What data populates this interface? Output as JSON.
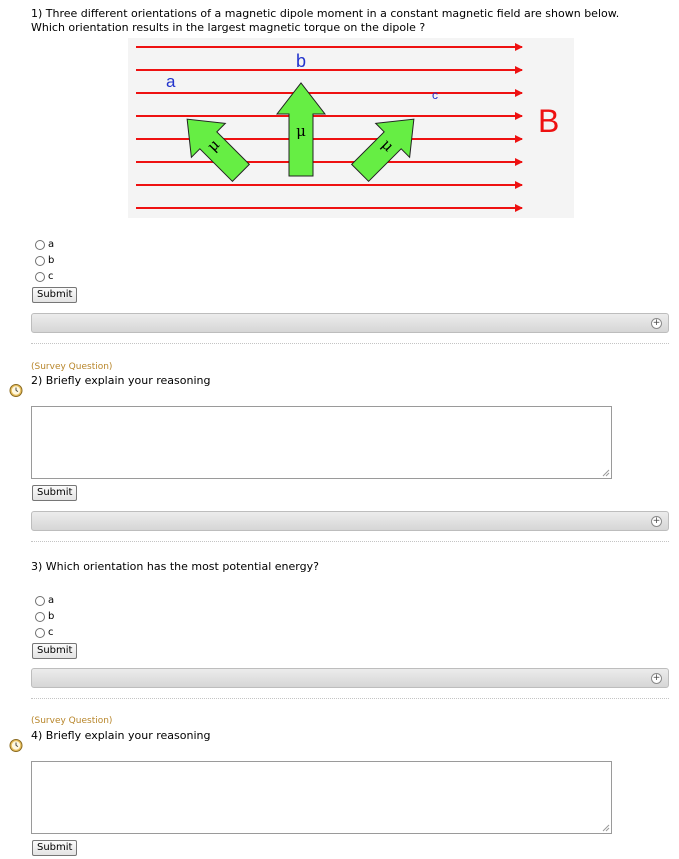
{
  "q1": {
    "text": "1) Three different orientations of a magnetic dipole moment in a constant magnetic field are shown below. Which orientation results in the largest magnetic torque on the dipole ?",
    "options": [
      "a",
      "b",
      "c"
    ],
    "submit": "Submit"
  },
  "figure": {
    "label_a": "a",
    "label_b": "b",
    "label_c": "c",
    "field_label": "B",
    "mu": "μ",
    "colors": {
      "field_line": "#ee1111",
      "arrow_fill": "#66ee44",
      "label_blue": "#2233cc",
      "bg": "#f4f4f4"
    }
  },
  "q2": {
    "survey": "(Survey Question)",
    "text": "2) Briefly explain your reasoning",
    "submit": "Submit"
  },
  "q3": {
    "text": "3) Which orientation has the most potential energy?",
    "options": [
      "a",
      "b",
      "c"
    ],
    "submit": "Submit"
  },
  "q4": {
    "survey": "(Survey Question)",
    "text": "4) Briefly explain your reasoning",
    "submit": "Submit"
  }
}
